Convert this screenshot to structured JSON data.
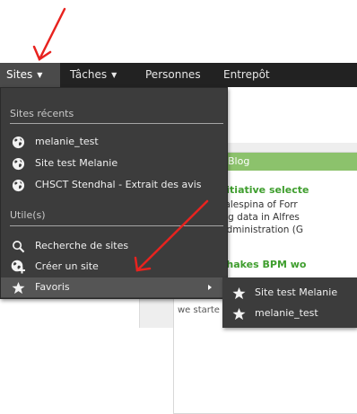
{
  "navbar": {
    "items": [
      {
        "label": "Sites",
        "has_caret": true,
        "active": true
      },
      {
        "label": "Tâches",
        "has_caret": true,
        "active": false
      },
      {
        "label": "Personnes",
        "has_caret": false,
        "active": false
      },
      {
        "label": "Entrepôt",
        "has_caret": false,
        "active": false
      }
    ],
    "caret_glyph": "▼"
  },
  "sites_menu": {
    "recent_heading": "Sites récents",
    "recent_sites": [
      {
        "label": "melanie_test",
        "icon": "globe-icon"
      },
      {
        "label": "Site test Melanie",
        "icon": "globe-icon"
      },
      {
        "label": "CHSCT Stendhal - Extrait des avis",
        "icon": "globe-icon"
      }
    ],
    "useful_heading": "Utile(s)",
    "useful_items": [
      {
        "label": "Recherche de sites",
        "icon": "search-icon"
      },
      {
        "label": "Créer un site",
        "icon": "create-site-icon"
      },
      {
        "label": "Favoris",
        "icon": "star-icon",
        "has_submenu": true
      }
    ]
  },
  "favorites_submenu": {
    "items": [
      {
        "label": "Site test Melanie",
        "icon": "star-icon"
      },
      {
        "label": "melanie_test",
        "icon": "star-icon"
      }
    ]
  },
  "background_blog": {
    "header": "Blog",
    "lines": [
      {
        "text": "M CFR initiative selecte",
        "style": "title"
      },
      {
        "text": "y Victor Malespina of Forr",
        "style": "body"
      },
      {
        "text": "engineering data in Alfres",
        "style": "body"
      },
      {
        "text": "Services Administration (G",
        "style": "body"
      },
      {
        "text": "Activiti shakes BPM wo",
        "style": "title"
      }
    ],
    "footer_text": "we starte"
  },
  "colors": {
    "navbar_bg": "#222222",
    "menu_bg": "#3c3c3c",
    "blog_header": "#8cc26c",
    "blog_title": "#3f9e2e",
    "annotation_arrow": "#e8231f"
  }
}
